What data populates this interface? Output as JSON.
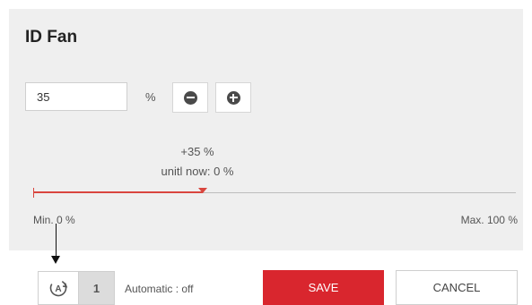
{
  "panel": {
    "title": "ID Fan",
    "value": "35",
    "unit": "%",
    "change_text": "+35 %",
    "until_now_text": "unitl now: 0 %",
    "min_label": "Min. 0 %",
    "max_label": "Max. 100 %"
  },
  "slider": {
    "min": 0,
    "max": 100,
    "value": 35,
    "fill_color": "#d9463e"
  },
  "icons": {
    "minus": "minus-circle-icon",
    "plus": "plus-circle-icon",
    "automatic": "automatic-mode-icon",
    "annotation_arrow": "arrow-down-icon"
  },
  "footer": {
    "auto_count": "1",
    "auto_status": "Automatic : off",
    "save_label": "SAVE",
    "cancel_label": "CANCEL"
  },
  "colors": {
    "accent": "#d9262e",
    "panel_bg": "#efefef"
  }
}
